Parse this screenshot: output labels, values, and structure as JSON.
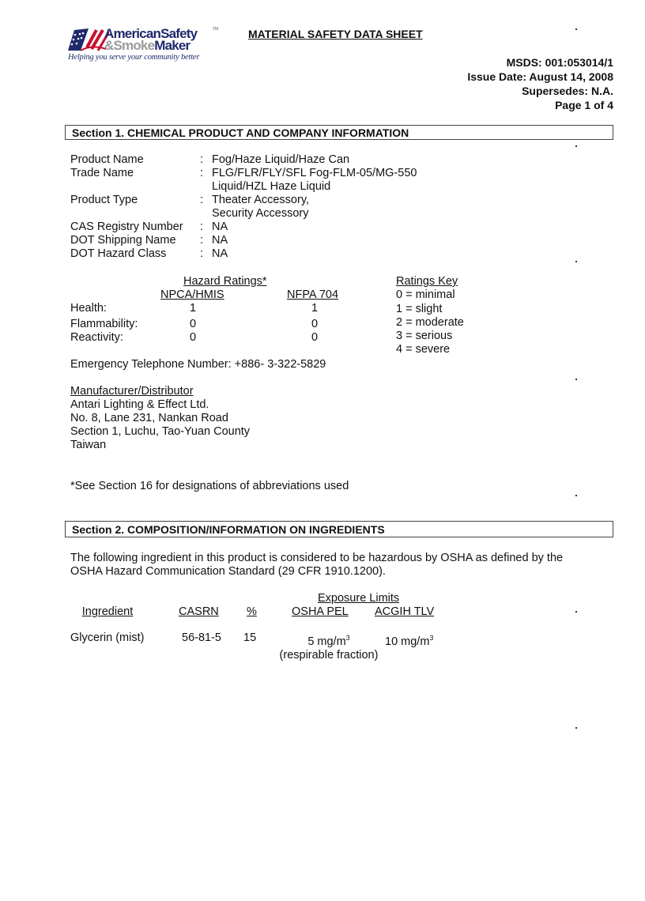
{
  "logo": {
    "line1": "AmericanSafety",
    "line2_amp": "&",
    "line2_a": "Smoke",
    "line2_b": "Maker",
    "tm": "TM",
    "tagline": "Helping you serve your community better",
    "colors": {
      "navy": "#1f2a6b",
      "red": "#c8102e",
      "gray": "#9a9a9a"
    }
  },
  "title": "MATERIAL SAFETY DATA SHEET",
  "meta": {
    "msds": "MSDS:  001:053014/1",
    "issue_date": "Issue Date: August 14, 2008",
    "supersedes": "Supersedes: N.A.",
    "page": "Page 1 of 4"
  },
  "section1": {
    "heading": "Section 1.  CHEMICAL PRODUCT AND COMPANY INFORMATION",
    "fields": [
      {
        "label": "Product Name",
        "value": [
          "Fog/Haze Liquid/Haze Can"
        ]
      },
      {
        "label": "Trade Name",
        "value": [
          "FLG/FLR/FLY/SFL Fog-FLM-05/MG-550",
          "Liquid/HZL Haze Liquid"
        ]
      },
      {
        "label": "Product Type",
        "value": [
          "Theater Accessory,",
          "Security Accessory"
        ]
      },
      {
        "label": "CAS Registry Number",
        "value": [
          "NA"
        ]
      },
      {
        "label": "DOT Shipping Name",
        "value": [
          "NA"
        ]
      },
      {
        "label": "DOT Hazard Class",
        "value": [
          "NA"
        ]
      }
    ],
    "separator": ":",
    "hazard": {
      "title": "Hazard Ratings*",
      "col1": "NPCA/HMIS",
      "col2": "NFPA 704",
      "rows": [
        {
          "label": "Health:",
          "hmis": "1",
          "nfpa": "1"
        },
        {
          "label": "Flammability:",
          "hmis": "0",
          "nfpa": "0"
        },
        {
          "label": "Reactivity:",
          "hmis": "0",
          "nfpa": "0"
        }
      ],
      "key_title": "Ratings Key",
      "key": [
        "0 = minimal",
        "1 = slight",
        "2 = moderate",
        "3 = serious",
        "4 = severe"
      ]
    },
    "emergency": "Emergency Telephone Number: +886- 3-322-5829",
    "manufacturer": {
      "title": "Manufacturer/Distributor",
      "lines": [
        "Antari Lighting & Effect Ltd.",
        "No. 8, Lane 231, Nankan Road",
        "Section 1, Luchu, Tao-Yuan County",
        "Taiwan"
      ]
    },
    "footnote": "*See Section 16 for designations of abbreviations used"
  },
  "section2": {
    "heading": "Section 2.    COMPOSITION/INFORMATION ON INGREDIENTS",
    "intro_line1": "The following ingredient in this product is considered to be hazardous by OSHA as defined by the",
    "intro_line2": "OSHA Hazard Communication Standard (29 CFR 1910.1200).",
    "table": {
      "exposure_header": "Exposure Limits",
      "headers": [
        "Ingredient",
        "CASRN",
        "%",
        "OSHA PEL",
        "ACGIH TLV"
      ],
      "rows": [
        {
          "ingredient": "Glycerin (mist)",
          "casrn": "56-81-5",
          "pct": "15",
          "osha_pel": "5 mg/m",
          "osha_pel_sup": "3",
          "osha_pel_note": "(respirable fraction)",
          "acgih_tlv": "10 mg/m",
          "acgih_tlv_sup": "3"
        }
      ]
    }
  }
}
